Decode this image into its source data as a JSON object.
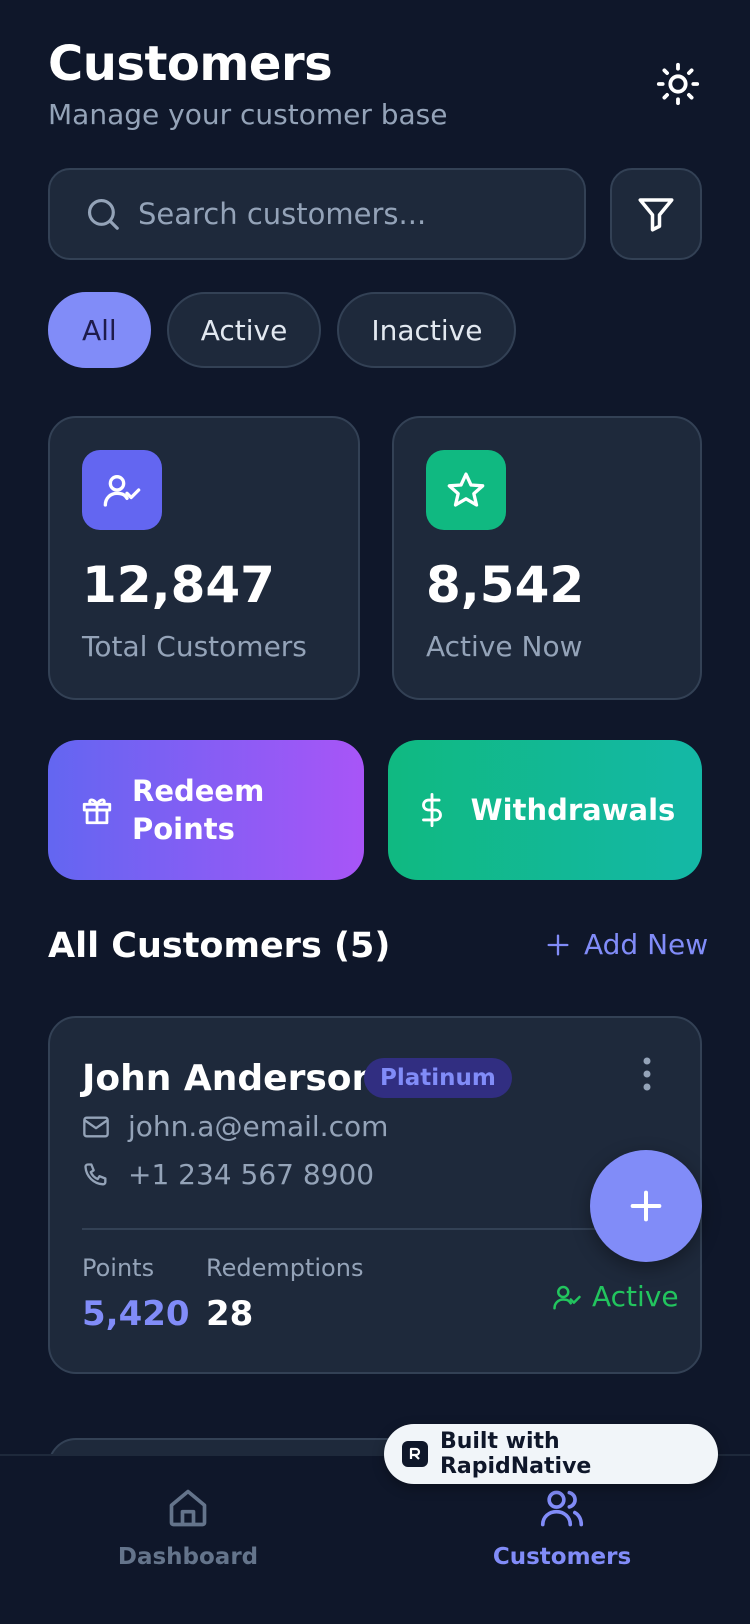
{
  "header": {
    "title": "Customers",
    "subtitle": "Manage your customer base",
    "theme_icon": "sun-icon"
  },
  "search": {
    "placeholder": "Search customers...",
    "value": ""
  },
  "filters": {
    "chips": [
      "All",
      "Active",
      "Inactive"
    ],
    "selected": "All"
  },
  "stats": [
    {
      "value": "12,847",
      "label": "Total Customers",
      "icon": "user-check-icon",
      "color": "#6366f1"
    },
    {
      "value": "8,542",
      "label": "Active Now",
      "icon": "star-icon",
      "color": "#10b981"
    }
  ],
  "actions": {
    "redeem_label": "Redeem Points",
    "withdraw_label": "Withdrawals"
  },
  "list": {
    "title": "All Customers (5)",
    "add_new_label": "Add New"
  },
  "customer": {
    "name": "John Anderson",
    "tier": "Platinum",
    "email": "john.a@email.com",
    "phone": "+1 234 567 8900",
    "points_label": "Points",
    "points_value": "5,420",
    "redemptions_label": "Redemptions",
    "redemptions_value": "28",
    "status": "Active"
  },
  "nav": {
    "dashboard_label": "Dashboard",
    "customers_label": "Customers",
    "active": "Customers"
  },
  "badge": {
    "text": "Built with RapidNative"
  },
  "colors": {
    "background": "#0f172a",
    "card": "#1e293b",
    "accent": "#818cf8",
    "success": "#22c55e"
  }
}
